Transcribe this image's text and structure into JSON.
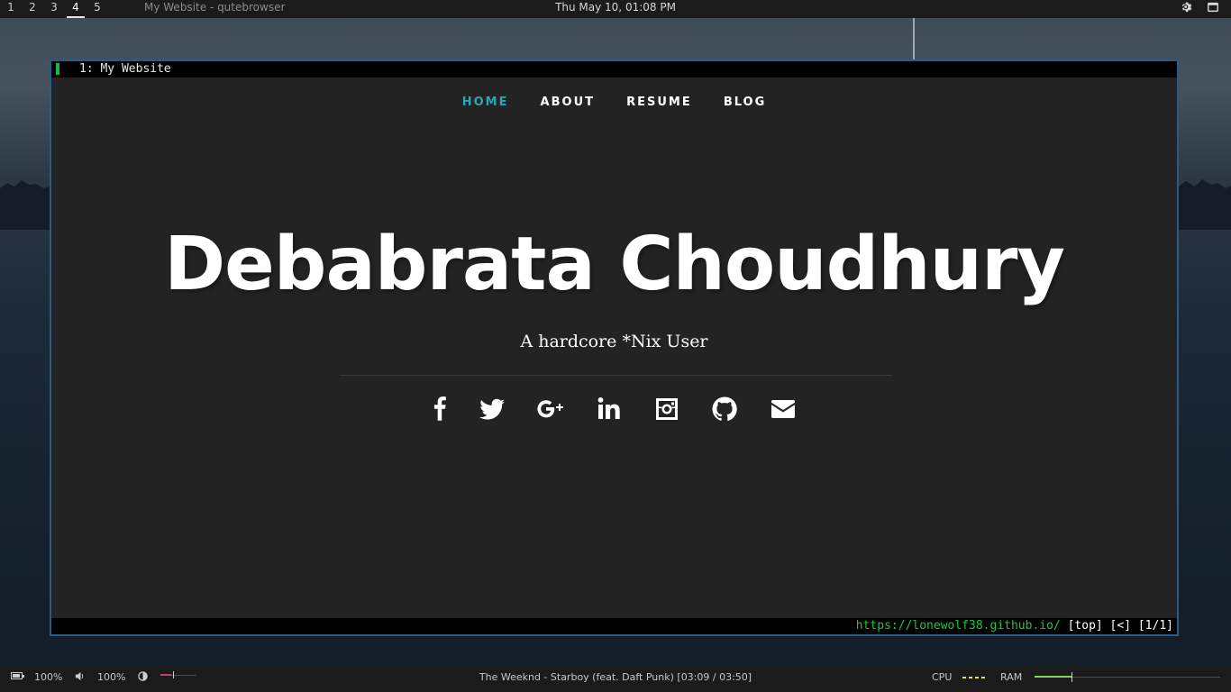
{
  "topbar": {
    "workspaces": [
      "1",
      "2",
      "3",
      "4",
      "5"
    ],
    "active_workspace": "4",
    "window_title": "My Website - qutebrowser",
    "clock": "Thu May 10, 01:08 PM",
    "icons": [
      "gear-icon",
      "window-icon"
    ]
  },
  "browser": {
    "tab_title": "1: My Website",
    "nav": [
      "HOME",
      "ABOUT",
      "RESUME",
      "BLOG"
    ],
    "nav_active": "HOME",
    "hero_title": "Debabrata Choudhury",
    "hero_subtitle": "A hardcore *Nix User",
    "social_icons": [
      "facebook-icon",
      "twitter-icon",
      "google-plus-icon",
      "linkedin-icon",
      "instagram-icon",
      "github-icon",
      "email-icon"
    ],
    "status": {
      "url": "https://lonewolf38.github.io/",
      "rest": " [top] [<] [1/1]"
    }
  },
  "bottombar": {
    "battery": "100%",
    "volume": "100%",
    "now_playing": "The Weeknd  -  Starboy (feat. Daft Punk) [03:09 / 03:50]",
    "cpu_label": "CPU",
    "ram_label": "RAM",
    "ram_fraction": 0.2,
    "brightness_fraction": 0.3
  },
  "colors": {
    "accent": "#2ba3b7",
    "window_border": "#2c5a86",
    "url_green": "#1ec936",
    "page_bg": "#232323"
  }
}
